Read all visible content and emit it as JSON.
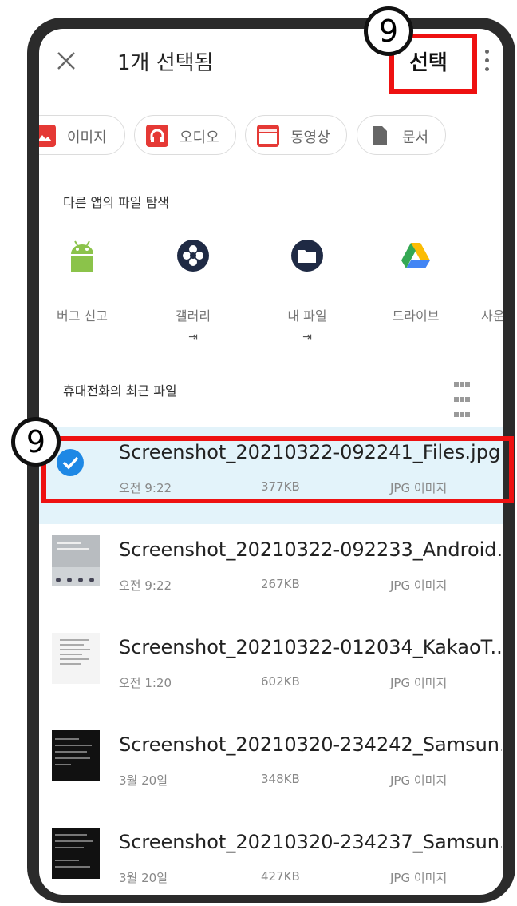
{
  "header": {
    "title": "1개 선택됨",
    "select_label": "선택"
  },
  "chips": [
    {
      "label": "이미지",
      "icon": "image-icon",
      "color": "#e53935"
    },
    {
      "label": "오디오",
      "icon": "headphones-icon",
      "color": "#e53935"
    },
    {
      "label": "동영상",
      "icon": "video-icon",
      "color": "#e53935"
    },
    {
      "label": "문서",
      "icon": "document-icon",
      "color": "#666666"
    }
  ],
  "apps_section": {
    "title": "다른 앱의 파일 탐색",
    "apps": [
      {
        "label": "버그 신고",
        "icon": "android-icon"
      },
      {
        "label": "갤러리",
        "icon": "gallery-icon",
        "ext": "⇥"
      },
      {
        "label": "내 파일",
        "icon": "my-files-icon",
        "ext": "⇥"
      },
      {
        "label": "드라이브",
        "icon": "drive-icon"
      },
      {
        "label": "사운",
        "icon": "app-icon"
      }
    ]
  },
  "recent_section": {
    "title": "휴대전화의 최근 파일"
  },
  "files": [
    {
      "name": "Screenshot_20210322-092241_Files.jpg",
      "time": "오전 9:22",
      "size": "377KB",
      "type": "JPG 이미지",
      "selected": true
    },
    {
      "name": "Screenshot_20210322-092233_Android...",
      "time": "오전 9:22",
      "size": "267KB",
      "type": "JPG 이미지",
      "selected": false
    },
    {
      "name": "Screenshot_20210322-012034_KakaoT...",
      "time": "오전 1:20",
      "size": "602KB",
      "type": "JPG 이미지",
      "selected": false
    },
    {
      "name": "Screenshot_20210320-234242_Samsun...",
      "time": "3월 20일",
      "size": "348KB",
      "type": "JPG 이미지",
      "selected": false
    },
    {
      "name": "Screenshot_20210320-234237_Samsun...",
      "time": "3월 20일",
      "size": "427KB",
      "type": "JPG 이미지",
      "selected": false
    }
  ],
  "annotations": {
    "step_top": "9",
    "step_row": "9",
    "highlight_color": "#ee1111"
  }
}
